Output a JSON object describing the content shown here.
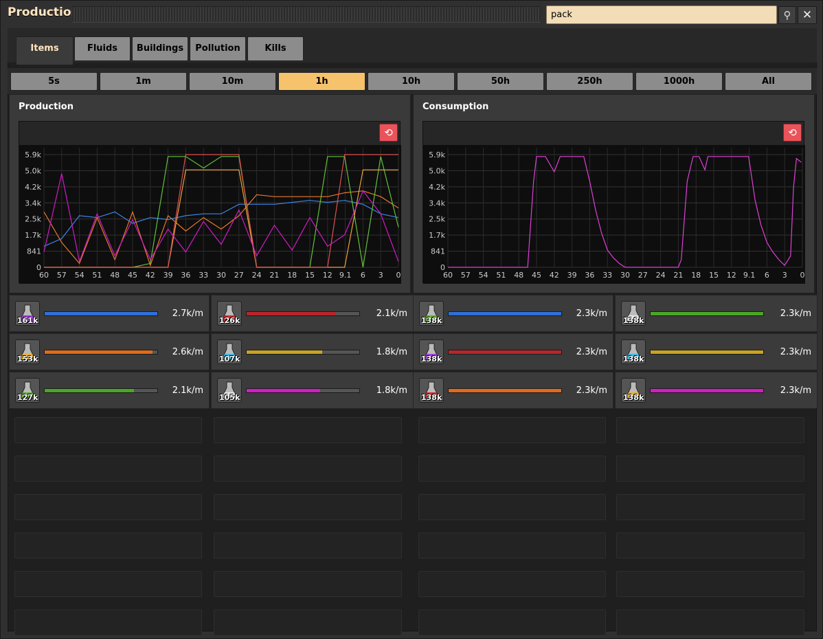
{
  "window": {
    "title": "Production"
  },
  "search": {
    "value": "pack"
  },
  "tabs": [
    {
      "label": "Items",
      "active": true
    },
    {
      "label": "Fluids"
    },
    {
      "label": "Buildings"
    },
    {
      "label": "Pollution"
    },
    {
      "label": "Kills"
    }
  ],
  "time_ranges": [
    {
      "label": "5s"
    },
    {
      "label": "1m"
    },
    {
      "label": "10m"
    },
    {
      "label": "1h",
      "active": true
    },
    {
      "label": "10h"
    },
    {
      "label": "50h"
    },
    {
      "label": "250h"
    },
    {
      "label": "1000h"
    },
    {
      "label": "All"
    }
  ],
  "production": {
    "title": "Production",
    "items": [
      {
        "count": "161k",
        "rate": "2.7k/m",
        "color": "#2f6fd6",
        "fill": 1.0,
        "icon": "purple-flask-icon"
      },
      {
        "count": "126k",
        "rate": "2.1k/m",
        "color": "#b8262b",
        "fill": 0.79,
        "icon": "red-flask-icon"
      },
      {
        "count": "153k",
        "rate": "2.6k/m",
        "color": "#e06a1a",
        "fill": 0.96,
        "icon": "yellow-flask-icon"
      },
      {
        "count": "107k",
        "rate": "1.8k/m",
        "color": "#c8a323",
        "fill": 0.67,
        "icon": "cyan-flask-icon"
      },
      {
        "count": "127k",
        "rate": "2.1k/m",
        "color": "#4aa626",
        "fill": 0.79,
        "icon": "green-flask-icon"
      },
      {
        "count": "105k",
        "rate": "1.8k/m",
        "color": "#d21cc6",
        "fill": 0.65,
        "icon": "white-flask-icon"
      }
    ]
  },
  "consumption": {
    "title": "Consumption",
    "items": [
      {
        "count": "138k",
        "rate": "2.3k/m",
        "color": "#2f6fd6",
        "fill": 1.0,
        "icon": "green-flask-icon"
      },
      {
        "count": "138k",
        "rate": "2.3k/m",
        "color": "#4aa626",
        "fill": 1.0,
        "icon": "white-flask-icon"
      },
      {
        "count": "138k",
        "rate": "2.3k/m",
        "color": "#b8262b",
        "fill": 1.0,
        "icon": "purple-flask-icon"
      },
      {
        "count": "138k",
        "rate": "2.3k/m",
        "color": "#c8a323",
        "fill": 1.0,
        "icon": "cyan-flask-icon"
      },
      {
        "count": "138k",
        "rate": "2.3k/m",
        "color": "#e06a1a",
        "fill": 1.0,
        "icon": "red-flask-icon"
      },
      {
        "count": "138k",
        "rate": "2.3k/m",
        "color": "#d21cc6",
        "fill": 1.0,
        "icon": "yellow-flask-icon"
      }
    ]
  },
  "chart_data": [
    {
      "type": "line",
      "title": "Production",
      "x_ticks": [
        "60",
        "57",
        "54",
        "51",
        "48",
        "45",
        "42",
        "39",
        "36",
        "33",
        "30",
        "27",
        "24",
        "21",
        "18",
        "15",
        "12",
        "9.1",
        "6",
        "3",
        "0"
      ],
      "y_ticks": [
        "0",
        "841",
        "1.7k",
        "2.5k",
        "3.4k",
        "4.2k",
        "5.0k",
        "5.9k"
      ],
      "ylim": [
        0,
        5900
      ],
      "xlim": [
        60,
        0
      ],
      "grid": true,
      "series": [
        {
          "color": "#3c86e6",
          "x": [
            60,
            57,
            54,
            51,
            48,
            45,
            42,
            39,
            36,
            33,
            30,
            27,
            24,
            21,
            18,
            15,
            12,
            9.1,
            6,
            3,
            0
          ],
          "values": [
            1100,
            1500,
            2700,
            2600,
            2900,
            2300,
            2600,
            2500,
            2700,
            2800,
            2800,
            3300,
            3300,
            3300,
            3400,
            3500,
            3400,
            3500,
            3300,
            2800,
            2600
          ]
        },
        {
          "color": "#e8792a",
          "x": [
            60,
            57,
            54,
            51,
            48,
            45,
            42,
            39,
            36,
            33,
            30,
            27,
            24,
            21,
            18,
            15,
            12,
            9.1,
            6,
            3,
            0
          ],
          "values": [
            2900,
            1300,
            200,
            2600,
            400,
            2900,
            100,
            2700,
            1900,
            2600,
            2000,
            2700,
            3800,
            3700,
            3700,
            3700,
            3700,
            3900,
            4000,
            3700,
            3100
          ]
        },
        {
          "color": "#62c23a",
          "x": [
            60,
            57,
            54,
            51,
            48,
            45,
            42,
            39,
            36,
            33,
            30,
            27,
            24,
            21,
            18,
            15,
            12,
            9.1,
            6,
            3,
            0
          ],
          "values": [
            0,
            0,
            0,
            0,
            0,
            0,
            200,
            5800,
            5800,
            5200,
            5800,
            5800,
            0,
            0,
            0,
            0,
            5800,
            5800,
            0,
            5800,
            2100
          ]
        },
        {
          "color": "#f0a23a",
          "x": [
            60,
            57,
            54,
            51,
            48,
            45,
            42,
            39,
            36,
            33,
            30,
            27,
            24,
            21,
            18,
            15,
            12,
            9.1,
            6,
            3,
            0
          ],
          "values": [
            0,
            0,
            0,
            0,
            0,
            0,
            0,
            0,
            5100,
            5100,
            5100,
            5100,
            0,
            0,
            0,
            0,
            0,
            0,
            5100,
            5100,
            5100
          ]
        },
        {
          "color": "#e05050",
          "x": [
            60,
            57,
            54,
            51,
            48,
            45,
            42,
            39,
            36,
            33,
            30,
            27,
            24,
            21,
            18,
            15,
            12,
            9.1,
            6,
            3,
            0
          ],
          "values": [
            0,
            0,
            0,
            0,
            0,
            0,
            0,
            0,
            5900,
            5900,
            5900,
            5900,
            0,
            0,
            0,
            0,
            0,
            5900,
            5900,
            5900,
            5900
          ]
        },
        {
          "color": "#d21cc6",
          "x": [
            60,
            57,
            54,
            51,
            48,
            45,
            42,
            39,
            36,
            33,
            30,
            27,
            24,
            21,
            18,
            15,
            12,
            9.1,
            6,
            3,
            0
          ],
          "values": [
            800,
            4900,
            300,
            2800,
            600,
            2500,
            400,
            2000,
            800,
            2400,
            1200,
            3000,
            600,
            2200,
            900,
            2600,
            1100,
            1700,
            4000,
            2800,
            300
          ]
        }
      ]
    },
    {
      "type": "line",
      "title": "Consumption",
      "x_ticks": [
        "60",
        "57",
        "54",
        "51",
        "48",
        "45",
        "42",
        "39",
        "36",
        "33",
        "30",
        "27",
        "24",
        "21",
        "18",
        "15",
        "12",
        "9.1",
        "6",
        "3",
        "0"
      ],
      "y_ticks": [
        "0",
        "841",
        "1.7k",
        "2.5k",
        "3.4k",
        "4.2k",
        "5.0k",
        "5.9k"
      ],
      "ylim": [
        0,
        5900
      ],
      "xlim": [
        60,
        0
      ],
      "grid": true,
      "series": [
        {
          "color": "#e040d8",
          "x": [
            60,
            54,
            48,
            46.5,
            45.5,
            45,
            43.5,
            42,
            41,
            39,
            37,
            36,
            35,
            34,
            33,
            32,
            31,
            30,
            28,
            24,
            21,
            20.5,
            19.5,
            18.5,
            17.5,
            16.5,
            16,
            15,
            12,
            10,
            9.1,
            8,
            7,
            6,
            5,
            4,
            3,
            2,
            1.5,
            1,
            0.2
          ],
          "values": [
            0,
            0,
            0,
            0,
            4500,
            5800,
            5800,
            5000,
            5800,
            5800,
            5800,
            4500,
            3000,
            1800,
            900,
            500,
            200,
            0,
            0,
            0,
            0,
            400,
            4500,
            5800,
            5800,
            5100,
            5800,
            5800,
            5800,
            5800,
            5800,
            3500,
            2200,
            1300,
            800,
            400,
            100,
            600,
            4200,
            5700,
            5500
          ]
        }
      ]
    }
  ]
}
